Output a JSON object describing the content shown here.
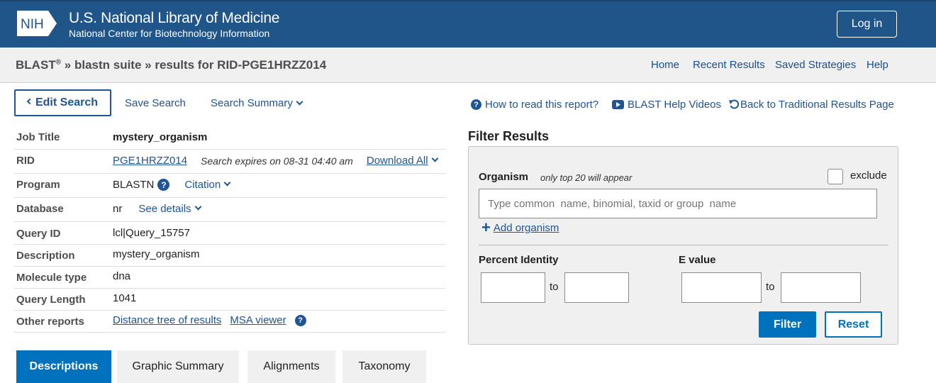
{
  "header": {
    "logo_text": "NIH",
    "title": "U.S. National Library of Medicine",
    "subtitle": "National Center for Biotechnology Information",
    "login_label": "Log in"
  },
  "breadcrumb": {
    "app": "BLAST",
    "reg": "®",
    "path": "» blastn suite » results for RID-PGE1HRZZ014"
  },
  "topnav": [
    "Home",
    "Recent Results",
    "Saved Strategies",
    "Help"
  ],
  "actions": {
    "edit_search": "Edit Search",
    "save_search": "Save Search",
    "search_summary": "Search Summary",
    "how_to_read": "How to read this report?",
    "help_videos": "BLAST Help Videos",
    "back_traditional": "Back to Traditional Results Page"
  },
  "job": {
    "labels": {
      "job_title": "Job Title",
      "rid": "RID",
      "program": "Program",
      "database": "Database",
      "query_id": "Query ID",
      "description": "Description",
      "molecule_type": "Molecule type",
      "query_length": "Query Length",
      "other_reports": "Other reports"
    },
    "job_title": "mystery_organism",
    "rid": "PGE1HRZZ014",
    "expires": "Search expires on 08-31 04:40 am",
    "download_all": "Download All",
    "program": "BLASTN",
    "citation": "Citation",
    "database": "nr",
    "see_details": "See details",
    "query_id": "lcl|Query_15757",
    "description": "mystery_organism",
    "molecule_type": "dna",
    "query_length": "1041",
    "distance_tree": "Distance tree of results",
    "msa_viewer": "MSA viewer"
  },
  "filter": {
    "title": "Filter Results",
    "organism_label": "Organism",
    "organism_hint": "only top 20 will appear",
    "exclude_label": "exclude",
    "organism_placeholder": "Type common  name, binomial, taxid or group  name",
    "add_organism": "Add organism",
    "percent_identity_label": "Percent Identity",
    "evalue_label": "E value",
    "to_label": "to",
    "filter_btn": "Filter",
    "reset_btn": "Reset"
  },
  "tabs": [
    "Descriptions",
    "Graphic Summary",
    "Alignments",
    "Taxonomy"
  ],
  "colors": {
    "header_bg": "#20558a",
    "link": "#205493",
    "primary_button": "#0071bc"
  }
}
